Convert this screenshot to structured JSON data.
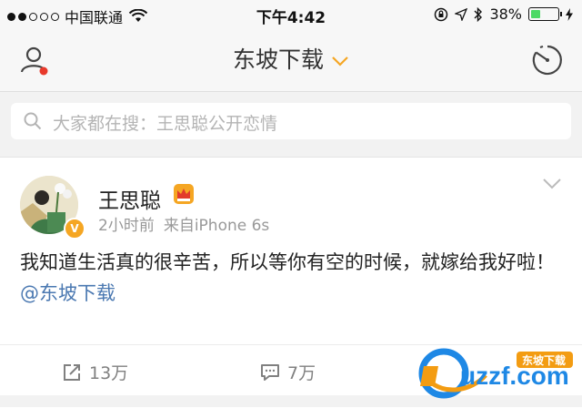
{
  "status_bar": {
    "carrier": "中国联通",
    "time": "下午4:42",
    "battery": "38%",
    "battery_level": 0.38
  },
  "nav": {
    "title": "东坡下载"
  },
  "search": {
    "placeholder": "大家都在搜：王思聪公开恋情"
  },
  "post": {
    "author": "王思聪",
    "time_ago": "2小时前",
    "source": "来自iPhone 6s",
    "text": "我知道生活真的很辛苦，所以等你有空的时候，就嫁给我好啦！",
    "mention": "@东坡下载"
  },
  "actions": {
    "repost_count": "13万",
    "comment_count": "7万"
  },
  "watermark": {
    "text": "uzzf.com",
    "badge": "东坡下载"
  },
  "colors": {
    "accent_orange": "#f5a623",
    "mention_blue": "#4a78b1",
    "battery_green": "#4cd964"
  },
  "icons": [
    "signal-dots",
    "wifi-icon",
    "lock-rotation-icon",
    "location-icon",
    "bluetooth-icon",
    "battery-icon",
    "charging-icon",
    "user-icon",
    "radar-icon",
    "search-icon",
    "crown-icon",
    "verified-icon",
    "chevron-down-icon",
    "repost-icon",
    "comment-icon"
  ]
}
